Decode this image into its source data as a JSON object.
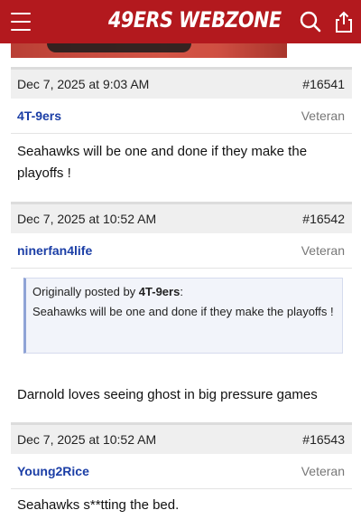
{
  "site": {
    "title": "49ERS WEBZONE"
  },
  "icons": {
    "menu": "hamburger-menu-icon",
    "search": "search-icon",
    "share": "share-icon"
  },
  "colors": {
    "header": "#b3191e",
    "username": "#1b3ea6"
  },
  "posts": [
    {
      "date": "Dec 7, 2025 at 9:03 AM",
      "number": "#16541",
      "author": "4T-9ers",
      "rank": "Veteran",
      "body": "Seahawks will be one and done if they make the playoffs !"
    },
    {
      "date": "Dec 7, 2025 at 10:52 AM",
      "number": "#16542",
      "author": "ninerfan4life",
      "rank": "Veteran",
      "quote": {
        "prefix": "Originally posted by",
        "author": "4T-9ers",
        "suffix": ":",
        "text": "Seahawks will be one and done if they make the playoffs !"
      },
      "body": "Darnold loves seeing ghost in big pressure games"
    },
    {
      "date": "Dec 7, 2025 at 10:52 AM",
      "number": "#16543",
      "author": "Young2Rice",
      "rank": "Veteran",
      "body": "Seahawks s**tting the bed."
    }
  ]
}
